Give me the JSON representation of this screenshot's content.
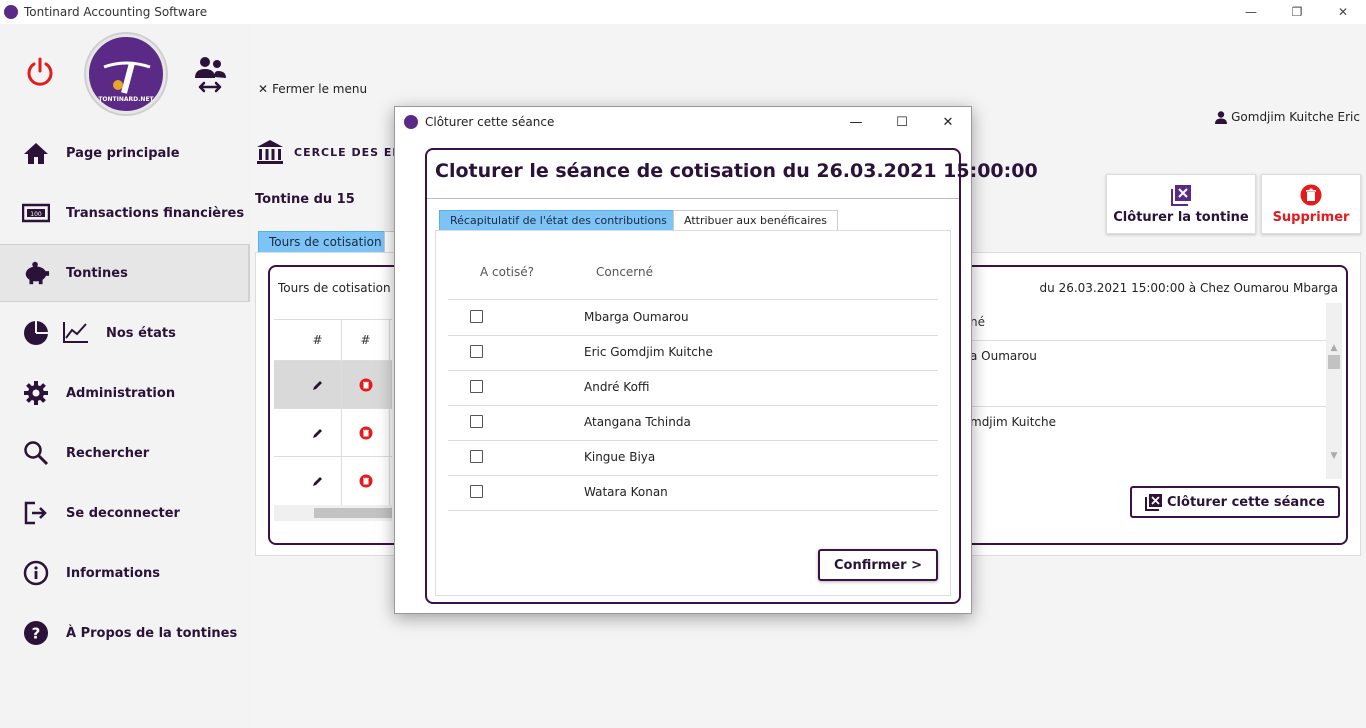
{
  "window": {
    "title": "Tontinard Accounting Software",
    "ctrl_min": "—",
    "ctrl_max": "❐",
    "ctrl_close": "✕"
  },
  "sidebar": {
    "logo_text": "TONTINARD.NET",
    "items": [
      {
        "label": "Page principale",
        "icon": "home-icon"
      },
      {
        "label": "Transactions financières",
        "icon": "banknote-icon"
      },
      {
        "label": "Tontines",
        "icon": "piggy-bank-icon"
      },
      {
        "label": "Nos états",
        "icon": "chart-icon"
      },
      {
        "label": "Administration",
        "icon": "gear-icon"
      },
      {
        "label": "Rechercher",
        "icon": "search-icon"
      },
      {
        "label": "Se deconnecter",
        "icon": "logout-icon"
      },
      {
        "label": "Informations",
        "icon": "info-icon"
      },
      {
        "label": "À Propos de la  tontines",
        "icon": "help-icon"
      }
    ]
  },
  "main": {
    "fermer_label": "Fermer le menu",
    "user_name": "Gomdjim Kuitche Eric",
    "bank_text": "CERCLE DES EN",
    "tontine_title": "Tontine du 15",
    "btn_cloturer_tontine": "Clôturer la tontine",
    "btn_supprimer": "Supprimer",
    "tab_tours": "Tours de cotisation",
    "panel_label": "Tours de cotisation",
    "date_info": "du 26.03.2021 15:00:00 à Chez Oumarou Mbarga",
    "grid_headers": [
      "#",
      "#"
    ],
    "right_header": "né",
    "right_row1": "a Oumarou",
    "right_row2": "mdjim Kuitche",
    "btn_cloturer_seance": "Clôturer cette séance"
  },
  "dialog": {
    "title": "Clôturer cette séance",
    "heading": "Cloturer le séance de cotisation du 26.03.2021 15:00:00",
    "tab1": "Récapitulatif de l'état des contributions",
    "tab2": "Attribuer aux benéficaires",
    "col_cotise": "A cotisé?",
    "col_concerne": "Concerné",
    "rows": [
      {
        "name": "Mbarga Oumarou",
        "checked": false
      },
      {
        "name": "Eric Gomdjim Kuitche",
        "checked": false
      },
      {
        "name": "André Koffi",
        "checked": false
      },
      {
        "name": "Atangana Tchinda",
        "checked": false
      },
      {
        "name": "Kingue Biya",
        "checked": false
      },
      {
        "name": "Watara Konan",
        "checked": false
      }
    ],
    "confirm_label": "Confirmer >"
  },
  "colors": {
    "accent_purple": "#2a1238",
    "brand_purple": "#5b2a86",
    "danger_red": "#e31b1b",
    "tab_blue": "#7dc3f5"
  }
}
